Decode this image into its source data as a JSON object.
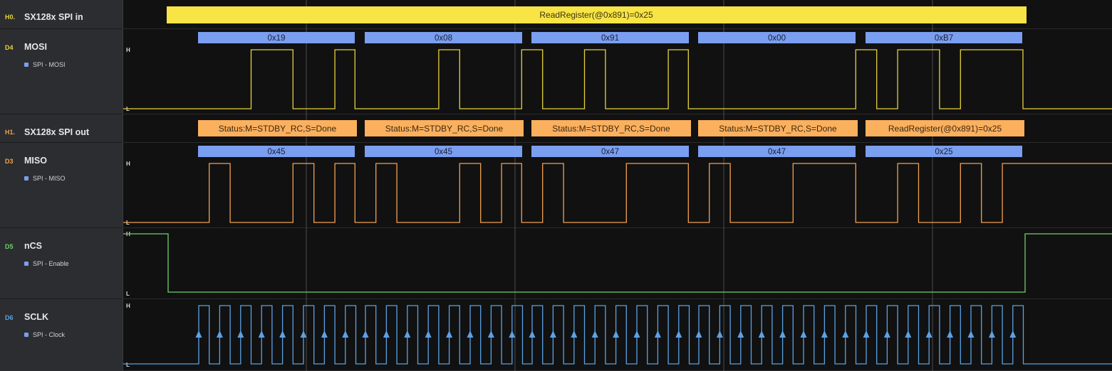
{
  "channels": [
    {
      "id": "h0",
      "tag": "H0.",
      "name": "SX128x SPI in",
      "tag_color": "#e6d23a"
    },
    {
      "id": "d4",
      "tag": "D4",
      "name": "MOSI",
      "sub": "SPI - MOSI",
      "tag_color": "#e6d23a"
    },
    {
      "id": "h1",
      "tag": "H1.",
      "name": "SX128x SPI out",
      "tag_color": "#f2a150"
    },
    {
      "id": "d3",
      "tag": "D3",
      "name": "MISO",
      "sub": "SPI - MISO",
      "tag_color": "#f2a150"
    },
    {
      "id": "d5",
      "tag": "D5",
      "name": "nCS",
      "sub": "SPI - Enable",
      "tag_color": "#6fcf6a"
    },
    {
      "id": "d6",
      "tag": "D6",
      "name": "SCLK",
      "sub": "SPI - Clock",
      "tag_color": "#5aa2e6"
    }
  ],
  "h0_frame": "ReadRegister(@0x891)=0x25",
  "mosi_bytes": [
    "0x19",
    "0x08",
    "0x91",
    "0x00",
    "0xB7"
  ],
  "h1_frames": [
    "Status:M=STDBY_RC,S=Done",
    "Status:M=STDBY_RC,S=Done",
    "Status:M=STDBY_RC,S=Done",
    "Status:M=STDBY_RC,S=Done",
    "ReadRegister(@0x891)=0x25"
  ],
  "miso_bytes": [
    "0x45",
    "0x45",
    "0x47",
    "0x47",
    "0x25"
  ],
  "level_labels": {
    "high": "H",
    "low": "L"
  },
  "colors": {
    "mosi": "#e6d23a",
    "miso": "#f2a150",
    "ncs": "#6fcf6a",
    "sclk": "#5aa2e6",
    "byte_box": "#7a9ef0",
    "h0_box": "#f8e445",
    "h1_box": "#fbb05e"
  }
}
